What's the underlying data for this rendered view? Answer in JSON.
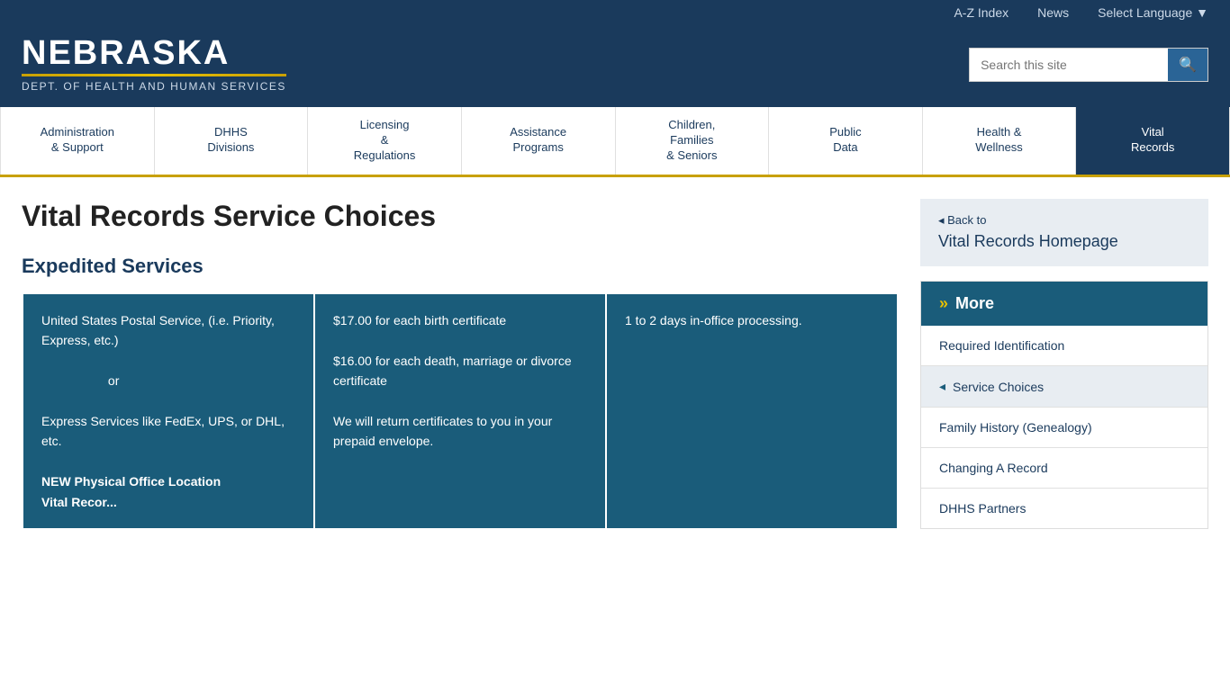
{
  "topbar": {
    "az_index": "A-Z  Index",
    "news": "News",
    "language": "Select  Language ▼"
  },
  "header": {
    "logo_nebraska": "NEBRASKA",
    "logo_subtitle": "DEPT. OF HEALTH AND HUMAN SERVICES",
    "search_placeholder": "Search this site"
  },
  "nav": {
    "items": [
      {
        "label": "Administration\n& Support",
        "active": false
      },
      {
        "label": "DHHS\nDivisions",
        "active": false
      },
      {
        "label": "Licensing\n&\nRegulations",
        "active": false
      },
      {
        "label": "Assistance\nPrograms",
        "active": false
      },
      {
        "label": "Children,\nFamilies\n& Seniors",
        "active": false
      },
      {
        "label": "Public\nData",
        "active": false
      },
      {
        "label": "Health &\nWellness",
        "active": false
      },
      {
        "label": "Vital\nRecords",
        "active": true
      }
    ]
  },
  "page": {
    "title": "Vital Records Service Choices",
    "section_title": "Expedited Services",
    "back_arrow": "◂ Back to",
    "back_title": "Vital Records Homepage"
  },
  "table": {
    "rows": [
      {
        "col1": "United States Postal Service, (i.e. Priority, Express, etc.)\n\nor\n\nExpress Services like FedEx, UPS, or DHL, etc.\n\nNEW Physical Office Location\nVital Recor...",
        "col2": "$17.00 for each birth certificate\n\n$16.00 for each death, marriage or divorce certificate\n\nWe will return certificates to you in your prepaid envelope.",
        "col3": "1 to 2 days in-office processing."
      }
    ]
  },
  "sidebar": {
    "more_label": "More",
    "items": [
      {
        "label": "Required Identification",
        "active": false
      },
      {
        "label": "Service Choices",
        "active": true
      },
      {
        "label": "Family History (Genealogy)",
        "active": false
      },
      {
        "label": "Changing A Record",
        "active": false
      },
      {
        "label": "DHHS Partners",
        "active": false
      }
    ]
  }
}
